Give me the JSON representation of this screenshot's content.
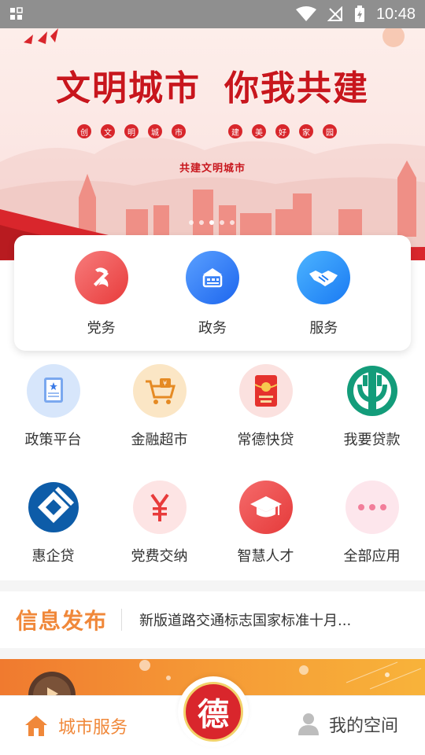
{
  "status_bar": {
    "time": "10:48"
  },
  "banner": {
    "title_left": "文明城市",
    "title_right": "你我共建",
    "slogan_chars": [
      "创",
      "文",
      "明",
      "城",
      "市",
      "",
      "建",
      "美",
      "好",
      "家",
      "园"
    ],
    "subtitle": "共建文明城市",
    "page_count": 5,
    "active_page": 2
  },
  "quick_actions": [
    {
      "label": "党务",
      "icon": "party-emblem-icon",
      "color": "#ee4b4b"
    },
    {
      "label": "政务",
      "icon": "government-building-icon",
      "color": "#2f7cf6"
    },
    {
      "label": "服务",
      "icon": "handshake-icon",
      "color": "#2a8ef7"
    }
  ],
  "grid_items": [
    {
      "label": "政策平台",
      "icon": "policy-document-icon"
    },
    {
      "label": "金融超市",
      "icon": "shopping-cart-icon"
    },
    {
      "label": "常德快贷",
      "icon": "red-envelope-icon"
    },
    {
      "label": "我要贷款",
      "icon": "bank-logo-icon"
    },
    {
      "label": "惠企贷",
      "icon": "ccb-logo-icon"
    },
    {
      "label": "党费交纳",
      "icon": "yuan-icon"
    },
    {
      "label": "智慧人才",
      "icon": "graduation-cap-icon"
    },
    {
      "label": "全部应用",
      "icon": "more-dots-icon"
    }
  ],
  "news": {
    "title": "信息发布",
    "headline": "新版道路交通标志国家标准十月..."
  },
  "bottom_nav": {
    "left_label": "城市服务",
    "center_char": "德",
    "right_label": "我的空间"
  },
  "colors": {
    "accent": "#f0883a",
    "party_red": "#d9262c"
  }
}
